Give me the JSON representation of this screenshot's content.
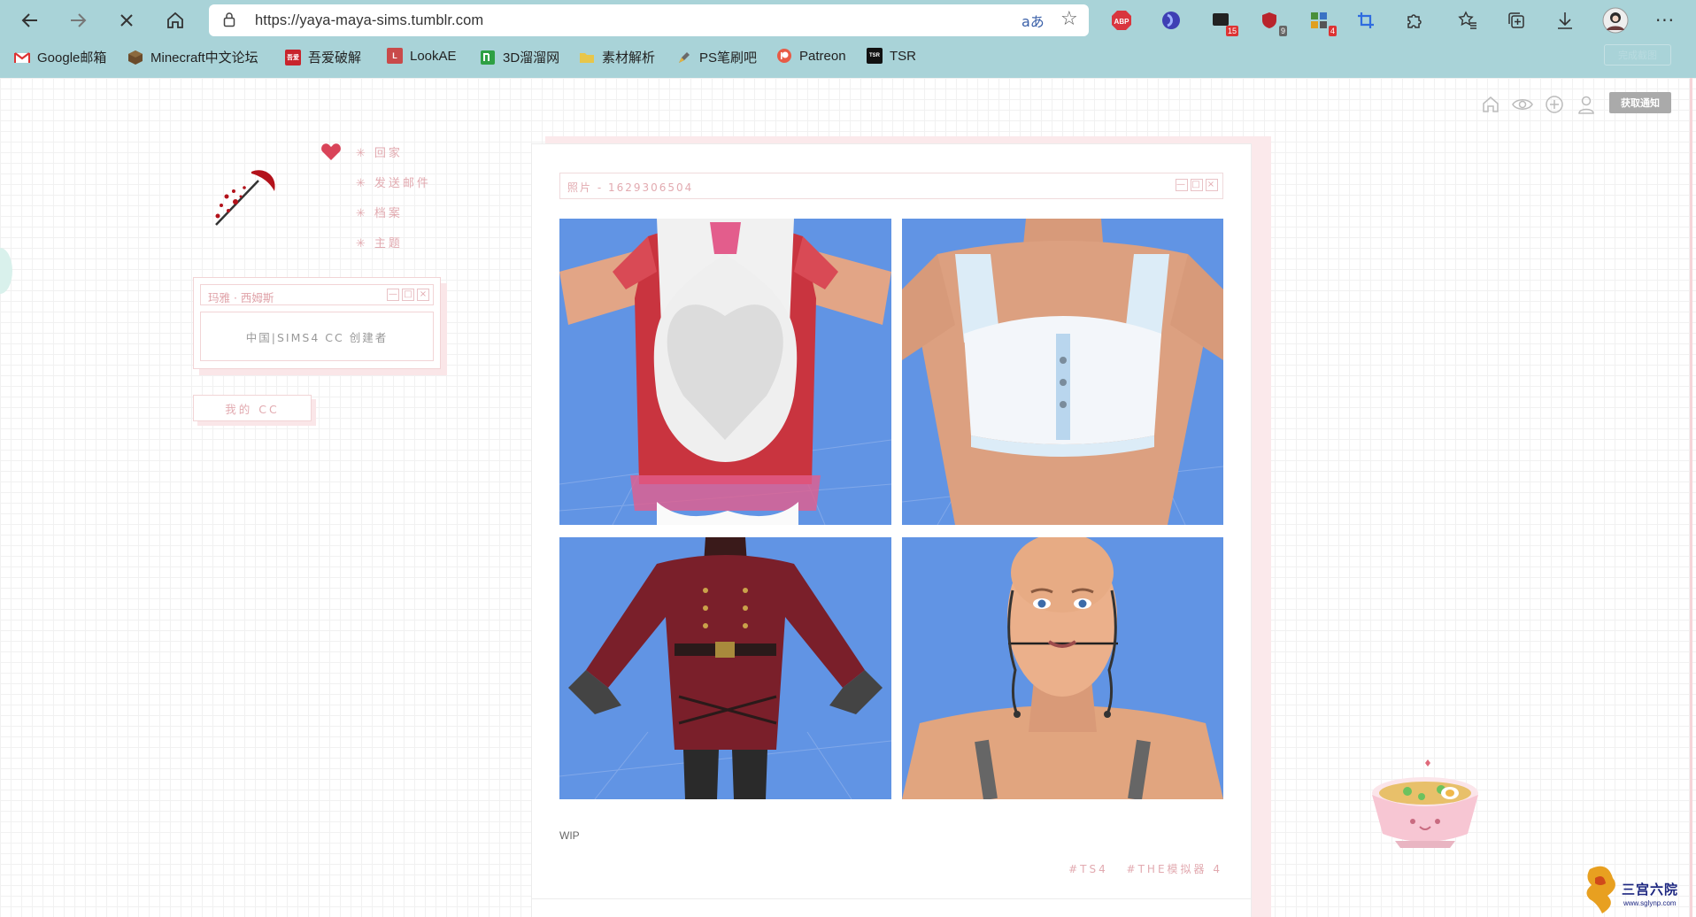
{
  "browser": {
    "url": "https://yaya-maya-sims.tumblr.com",
    "read_aloud": "aあ",
    "extensions": [
      {
        "name": "adblock-plus",
        "label": "ABP"
      },
      {
        "name": "extension-blue-orb"
      },
      {
        "name": "extension-dark-square",
        "badge": "15"
      },
      {
        "name": "extension-red-shield",
        "badge": "9"
      },
      {
        "name": "extension-blocks",
        "badge": "4"
      },
      {
        "name": "crop-extension"
      },
      {
        "name": "puzzle-extensions"
      }
    ],
    "screenshot_button_label": "完成截图",
    "bookmarks": [
      {
        "label": "Google邮箱",
        "icon": "gmail-icon"
      },
      {
        "label": "Minecraft中文论坛",
        "icon": "minecraft-icon"
      },
      {
        "label": "吾爱破解",
        "icon": "52pojie-icon"
      },
      {
        "label": "LookAE",
        "icon": "lookae-icon"
      },
      {
        "label": "3D溜溜网",
        "icon": "3d66-icon"
      },
      {
        "label": "素材解析",
        "icon": "folder-icon"
      },
      {
        "label": "PS笔刷吧",
        "icon": "ps-brush-icon"
      },
      {
        "label": "Patreon",
        "icon": "patreon-icon"
      },
      {
        "label": "TSR",
        "icon": "tsr-icon"
      }
    ],
    "bookmark_icon_texts": {
      "tsr": "TSR",
      "52pojie": "吾爱",
      "lookae": "L"
    }
  },
  "page": {
    "top_icons": [
      "home-icon",
      "eye-icon",
      "plus-circle-icon",
      "person-icon"
    ],
    "notice_button": "获取通知",
    "menu": [
      {
        "label": "回家"
      },
      {
        "label": "发送邮件"
      },
      {
        "label": "档案"
      },
      {
        "label": "主题"
      }
    ],
    "menu_bullet": "✳",
    "profile": {
      "title": "玛雅 · 西姆斯",
      "description": "中国|SIMS4 CC 创建者",
      "my_cc_button": "我的 CC"
    },
    "post": {
      "photo_bar_label": "照片 - 1629306504",
      "caption": "WIP",
      "tags": [
        "#TS4",
        "#THE模拟器 4"
      ]
    },
    "window_controls": [
      "—",
      "□",
      "×"
    ],
    "watermark": {
      "text": "三宫六院",
      "url": "www.sglynp.com"
    }
  },
  "colors": {
    "browser_chrome": "#a9d3d8",
    "accent_pink": "#e2aab0",
    "photo_background": "#6194e4"
  }
}
